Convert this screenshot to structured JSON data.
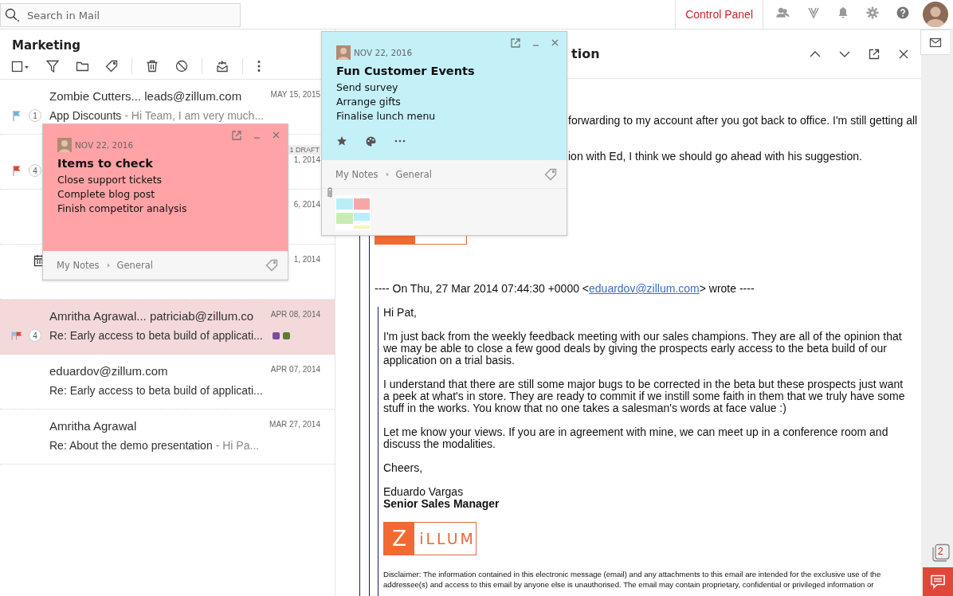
{
  "search": {
    "placeholder": "Search in Mail"
  },
  "topbar": {
    "control_panel": "Control Panel"
  },
  "folder": {
    "title": "Marketing"
  },
  "mails": [
    {
      "sender": "Zombie Cutters... leads@zillum.com",
      "date": "MAY 15, 2015",
      "flags": [
        {
          "color": "#6cb4e0"
        }
      ],
      "count": "1",
      "subject": "App Discounts",
      "preview": "- Hi Team, I am very much...",
      "selected": false
    },
    {
      "draft": "1 DRAFT",
      "date": "1, 2014",
      "flags": [
        {
          "color": "#e0432a"
        }
      ],
      "count": "4",
      "selected": false
    },
    {
      "date": "6, 2014",
      "selected": false
    },
    {
      "kind": "event",
      "date": "1, 2014",
      "selected": false
    },
    {
      "sender": "Amritha Agrawal... patriciab@zillum.co",
      "date": "APR 08, 2014",
      "flags": [
        {
          "color": "#8cc4e6"
        },
        {
          "color": "#e0432a"
        }
      ],
      "count": "4",
      "subject": "Re: Early access to beta build of applicati...",
      "tags": [
        {
          "color": "#7d4aa6"
        },
        {
          "color": "#5e7b36"
        }
      ],
      "selected": true
    },
    {
      "sender": "eduardov@zillum.com",
      "date": "APR 07, 2014",
      "subject": "Re: Early access to beta build of applicati...",
      "selected": false
    },
    {
      "sender": "Amritha Agrawal",
      "date": "MAR 27, 2014",
      "subject": "Re: About the demo presentation",
      "preview": "- Hi Pa...",
      "selected": false
    }
  ],
  "reader": {
    "title": "tion",
    "fragments": [
      "forwarding to my account after you got back to office. I'm still getting all",
      "ion with Ed, I think we should go ahead with his suggestion."
    ],
    "quote_header": {
      "before": "---- On Thu, 27 Mar 2014 07:44:30 +0000 <",
      "link": "eduardov@zillum.com",
      "after": "> wrote ----"
    },
    "greeting": "Hi Pat,",
    "paragraphs": [
      "I'm just back from the weekly feedback meeting with our sales champions. They are all of the opinion that we may be able to close a few good deals by giving the prospects early access to the beta build of our application on a trial basis.",
      "I understand that there are still some major bugs to be corrected in the beta but these prospects just want a peek at what's in store. They are ready to commit if we instill some faith in them that we truly have some stuff in the works. You know that no one takes a salesman's words at face value :)",
      "Let me know your views. If you are in agreement with mine, we can meet up in a conference room and discuss the modalities."
    ],
    "closing": "Cheers,",
    "signature_name": "Eduardo Vargas",
    "signature_title": "Senior Sales Manager",
    "logo": {
      "letter": "Z",
      "word": "iLLUM"
    },
    "disclaimer": "Disclaimer: The information contained in this electronic message (email) and any attachments to this email are intended for the exclusive use of the addressee(s) and access to this email by anyone else is unauthorised. The email may contain proprietary, confidential or privileged information or"
  },
  "side": {
    "badge": "2"
  },
  "notes": [
    {
      "color": "#ffa3a6",
      "date": "NOV 22, 2016",
      "title": "Items to check",
      "items": [
        "Close support tickets",
        "Complete blog post",
        "Finish competitor analysis"
      ],
      "notebook": "My Notes",
      "section": "General",
      "toolbar": false,
      "attachment": false
    },
    {
      "color": "#c4f0f8",
      "date": "NOV 22, 2016",
      "title": "Fun Customer Events",
      "items": [
        "Send survey",
        "Arrange gifts",
        "Finalise lunch menu"
      ],
      "notebook": "My Notes",
      "section": "General",
      "toolbar": true,
      "attachment": true
    }
  ]
}
